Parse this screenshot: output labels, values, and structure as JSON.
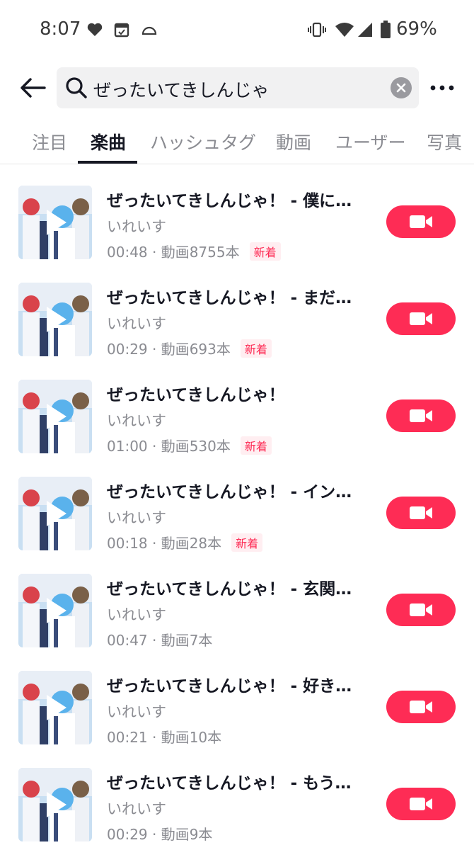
{
  "status_bar": {
    "time": "8:07",
    "battery": "69%",
    "icons": [
      "heart-icon",
      "calendar-icon",
      "cloud-icon",
      "vibrate-icon",
      "wifi-icon",
      "signal-icon",
      "battery-icon"
    ]
  },
  "search": {
    "query": "ぜったいてきしんじゃ",
    "icons": {
      "back": "back-arrow-icon",
      "search": "search-icon",
      "clear": "clear-icon",
      "more": "more-icon"
    }
  },
  "tabs": [
    {
      "label": "注目",
      "active": false
    },
    {
      "label": "楽曲",
      "active": true
    },
    {
      "label": "ハッシュタグ",
      "active": false
    },
    {
      "label": "動画",
      "active": false
    },
    {
      "label": "ユーザー",
      "active": false
    },
    {
      "label": "写真",
      "active": false
    }
  ],
  "results": [
    {
      "title": "ぜったいてきしんじゃ！ - 僕に…",
      "artist": "いれいす",
      "meta": "00:48 · 動画8755本",
      "badge": "新着"
    },
    {
      "title": "ぜったいてきしんじゃ！ - まだ…",
      "artist": "いれいす",
      "meta": "00:29 · 動画693本",
      "badge": "新着"
    },
    {
      "title": "ぜったいてきしんじゃ！",
      "artist": "いれいす",
      "meta": "01:00 · 動画530本",
      "badge": "新着"
    },
    {
      "title": "ぜったいてきしんじゃ！ - イン…",
      "artist": "いれいす",
      "meta": "00:18 · 動画28本",
      "badge": "新着"
    },
    {
      "title": "ぜったいてきしんじゃ！ - 玄関…",
      "artist": "いれいす",
      "meta": "00:47 · 動画7本",
      "badge": ""
    },
    {
      "title": "ぜったいてきしんじゃ！ - 好き…",
      "artist": "いれいす",
      "meta": "00:21 · 動画10本",
      "badge": ""
    },
    {
      "title": "ぜったいてきしんじゃ！ - もう…",
      "artist": "いれいす",
      "meta": "00:29 · 動画9本",
      "badge": ""
    }
  ],
  "colors": {
    "accent": "#fe2c55",
    "text": "#161823",
    "muted": "#8a8b91"
  }
}
